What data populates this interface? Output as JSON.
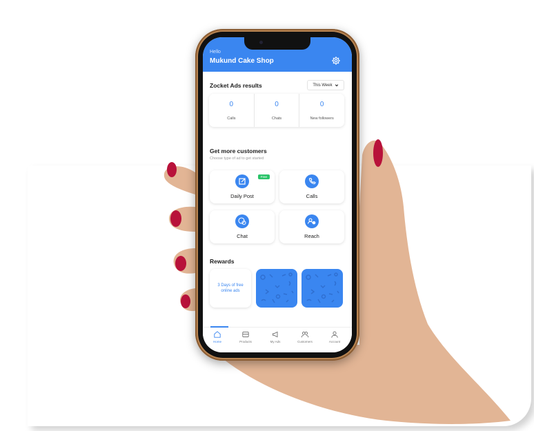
{
  "header": {
    "greeting": "Hello",
    "shop_name": "Mukund Cake Shop",
    "settings_icon": "gear-icon"
  },
  "ads_results": {
    "title": "Zocket Ads results",
    "period": "This Week",
    "stats": [
      {
        "value": "0",
        "label": "Calls"
      },
      {
        "value": "0",
        "label": "Chats"
      },
      {
        "value": "0",
        "label": "New followers"
      }
    ]
  },
  "customers": {
    "title": "Get more customers",
    "subtitle": "Choose type of ad to get started",
    "options": [
      {
        "label": "Daily Post",
        "icon": "edit-icon",
        "badge": "Free"
      },
      {
        "label": "Calls",
        "icon": "phone-icon"
      },
      {
        "label": "Chat",
        "icon": "chat-icon"
      },
      {
        "label": "Reach",
        "icon": "reach-icon"
      }
    ]
  },
  "rewards": {
    "title": "Rewards",
    "cards": [
      {
        "text": "3 Days of free online ads"
      }
    ]
  },
  "nav": {
    "items": [
      {
        "label": "Home",
        "icon": "home-icon",
        "active": true
      },
      {
        "label": "Products",
        "icon": "store-icon"
      },
      {
        "label": "My Ads",
        "icon": "megaphone-icon"
      },
      {
        "label": "Customers",
        "icon": "users-icon"
      },
      {
        "label": "Account",
        "icon": "user-icon"
      }
    ]
  },
  "colors": {
    "accent": "#3a86f0",
    "badge": "#2bc46a"
  }
}
